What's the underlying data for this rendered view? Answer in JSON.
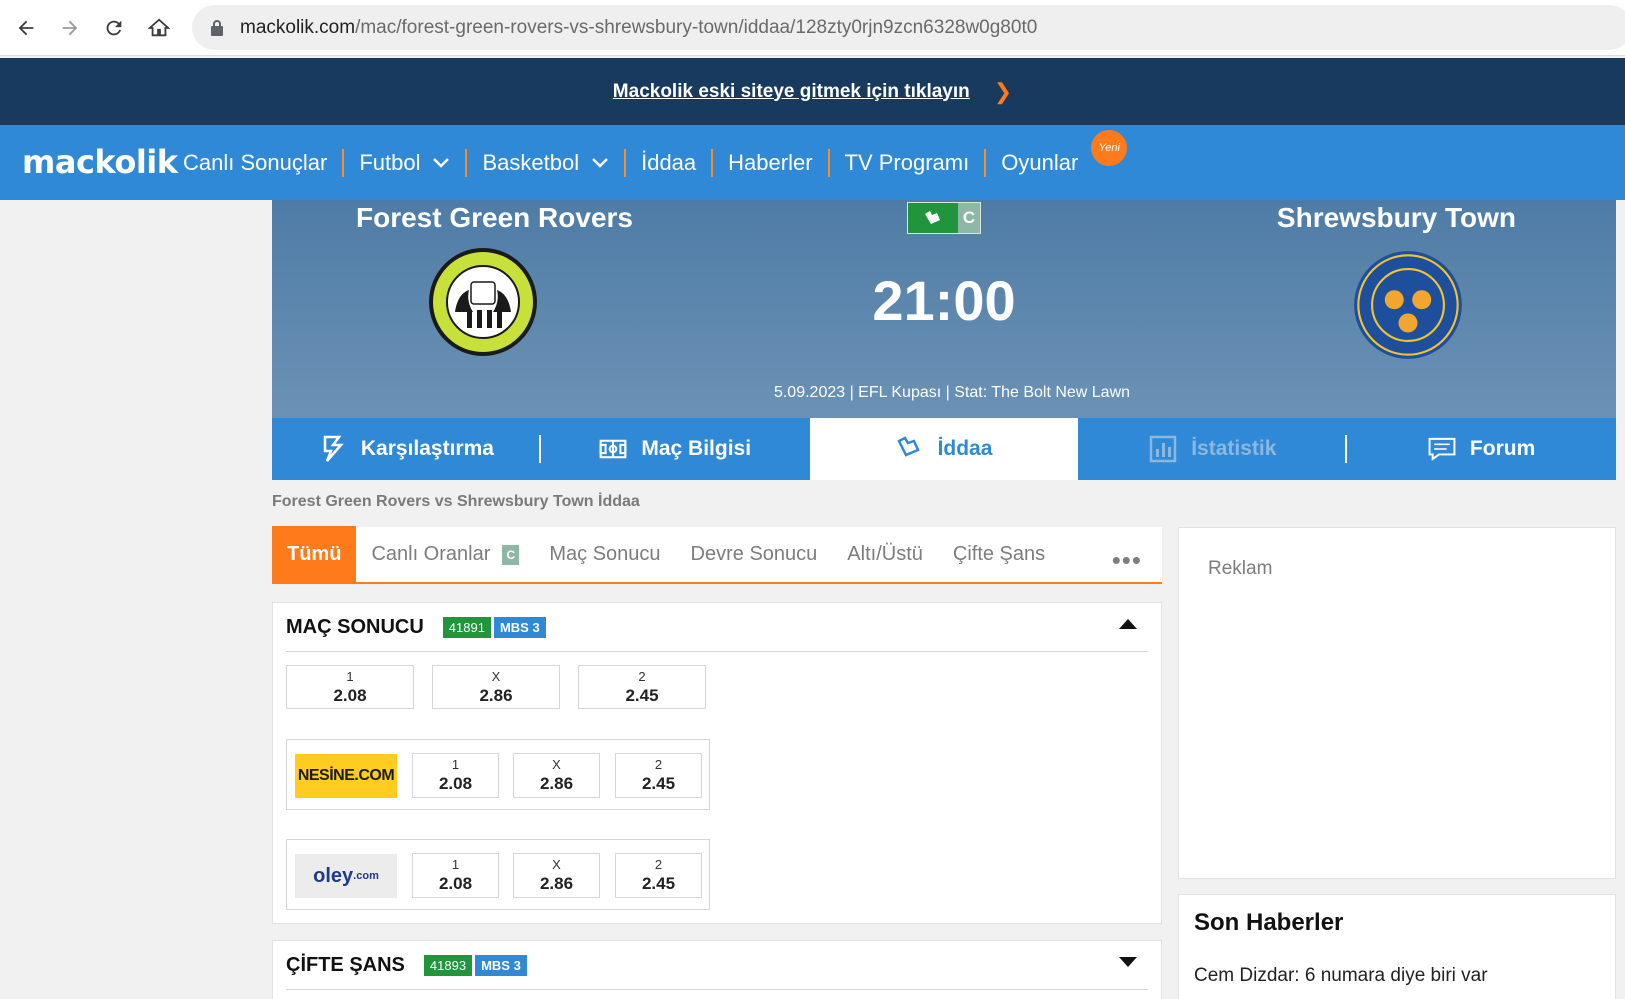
{
  "browser": {
    "url_host": "mackolik.com",
    "url_path": "/mac/forest-green-rovers-vs-shrewsbury-town/iddaa/128zty0rjn9zcn6328w0g80t0"
  },
  "banner": {
    "text": "Mackolik eski siteye gitmek için tıklayın"
  },
  "nav": {
    "logo": "mackolik",
    "items": [
      "Canlı Sonuçlar",
      "Futbol",
      "Basketbol",
      "İddaa",
      "Haberler",
      "TV Programı",
      "Oyunlar"
    ],
    "new_badge": "Yeni"
  },
  "match": {
    "home": "Forest Green Rovers",
    "away": "Shrewsbury Town",
    "time": "21:00",
    "live_chip_letter": "C",
    "meta": "5.09.2023 | EFL Kupası | Stat: The Bolt New Lawn"
  },
  "section_tabs": [
    "Karşılaştırma",
    "Maç Bilgisi",
    "İddaa",
    "İstatistik",
    "Forum"
  ],
  "breadcrumb": "Forest Green Rovers vs Shrewsbury Town İddaa",
  "filters": {
    "tabs": [
      "Tümü",
      "Canlı Oranlar",
      "Maç Sonucu",
      "Devre Sonucu",
      "Altı/Üstü",
      "Çifte Şans"
    ],
    "live_badge": "C",
    "more": "•••"
  },
  "markets": [
    {
      "title": "MAÇ SONUCU",
      "code": "41891",
      "mbs": "MBS 3",
      "odds": [
        {
          "label": "1",
          "value": "2.08"
        },
        {
          "label": "X",
          "value": "2.86"
        },
        {
          "label": "2",
          "value": "2.45"
        }
      ],
      "providers": [
        {
          "name": "NESİNE.COM",
          "odds": [
            {
              "label": "1",
              "value": "2.08"
            },
            {
              "label": "X",
              "value": "2.86"
            },
            {
              "label": "2",
              "value": "2.45"
            }
          ]
        },
        {
          "name": "oley",
          "suffix": ".com",
          "odds": [
            {
              "label": "1",
              "value": "2.08"
            },
            {
              "label": "X",
              "value": "2.86"
            },
            {
              "label": "2",
              "value": "2.45"
            }
          ]
        }
      ]
    },
    {
      "title": "ÇİFTE ŞANS",
      "code": "41893",
      "mbs": "MBS 3"
    }
  ],
  "sidebar": {
    "ad_label": "Reklam",
    "news_title": "Son Haberler",
    "news_items": [
      "Cem Dizdar: 6 numara diye biri var"
    ]
  },
  "colors": {
    "nav_blue": "#2f89d6",
    "banner_navy": "#173a5e",
    "accent_orange": "#ff7a1a",
    "code_green": "#21953b"
  }
}
